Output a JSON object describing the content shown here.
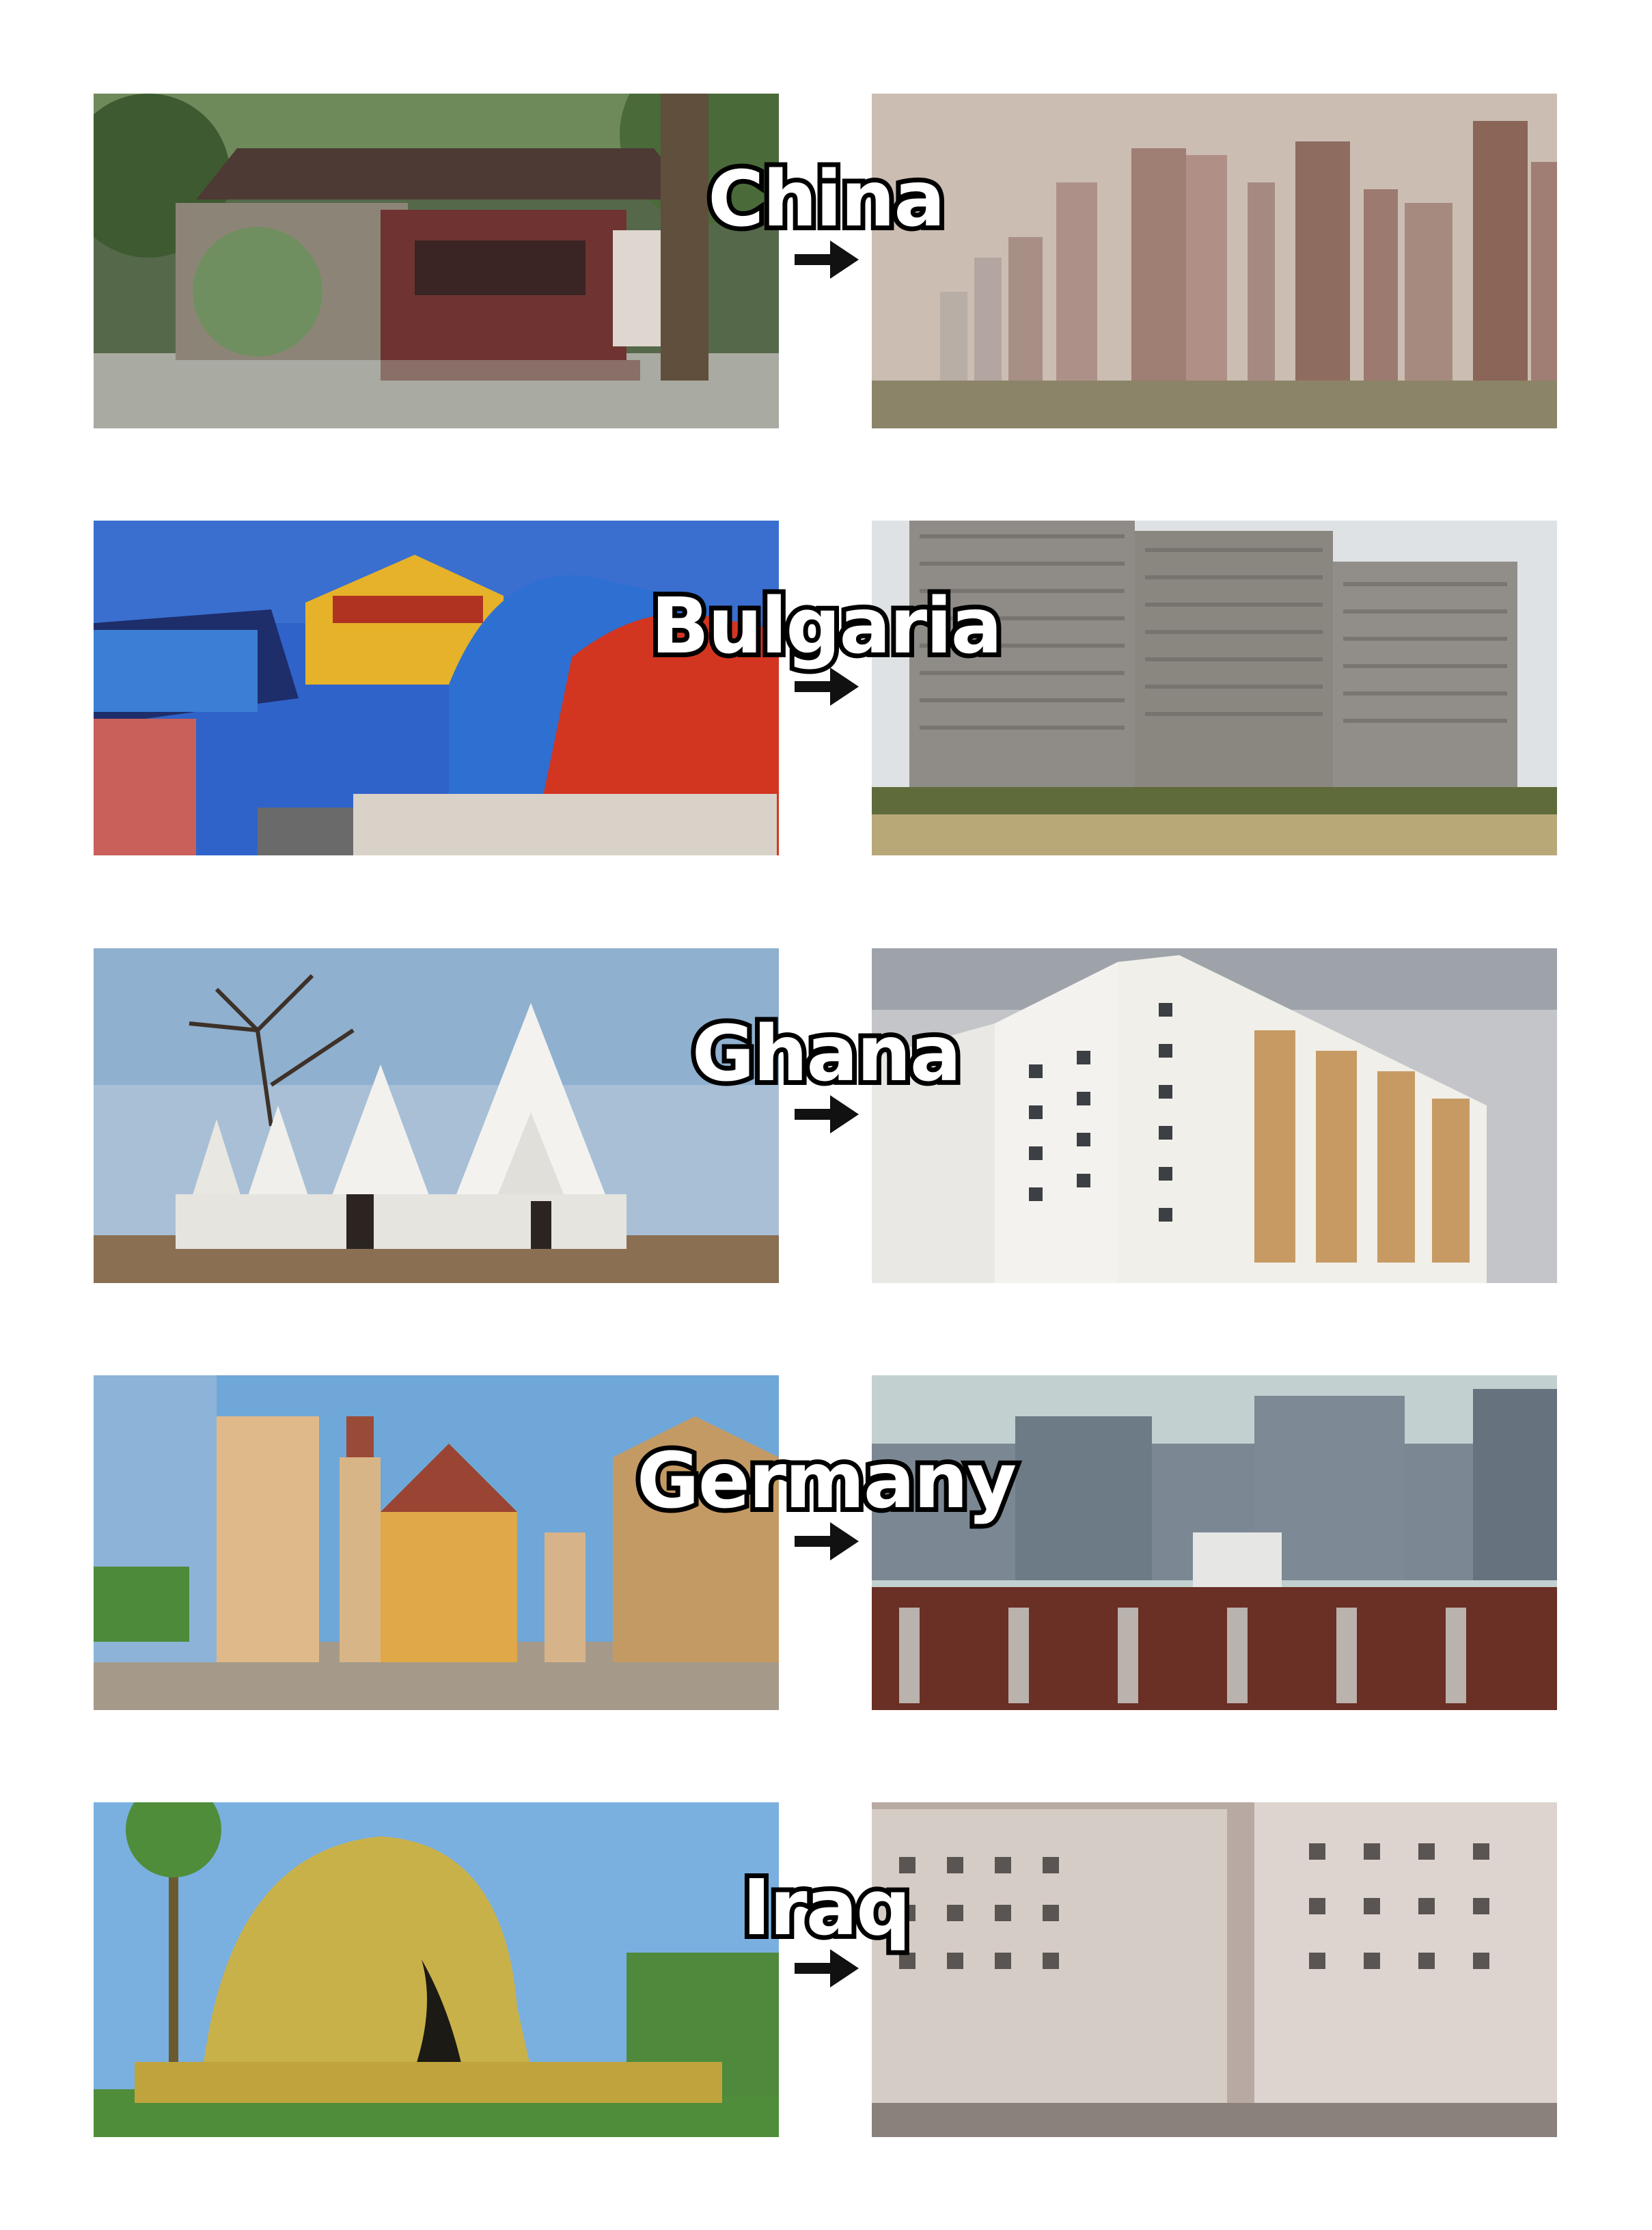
{
  "comparisons": [
    {
      "country": "China",
      "traditional_photo": "traditional Chinese courtyard house with moon gate",
      "modern_photo": "hazy skyline of identical high-rise apartment towers"
    },
    {
      "country": "Bulgaria",
      "traditional_photo": "colourful Bulgarian revival houses with red ivy",
      "modern_photo": "grey socialist-era concrete panel blocks"
    },
    {
      "country": "Ghana",
      "traditional_photo": "white Sudano-Sahelian mud mosque with spires",
      "modern_photo": "white apartment block with tan balconies"
    },
    {
      "country": "Germany",
      "traditional_photo": "half-timbered old town street with clock tower",
      "modern_photo": "grey and brown modern apartment buildings"
    },
    {
      "country": "Iraq",
      "traditional_photo": "reed mudhif house in the marshes",
      "modern_photo": "beige modern apartment blocks"
    }
  ],
  "icons": {
    "arrow": "arrow-right-icon"
  },
  "colors": {
    "label_text": "#ffffff",
    "label_outline": "#000000",
    "arrow": "#111111"
  }
}
